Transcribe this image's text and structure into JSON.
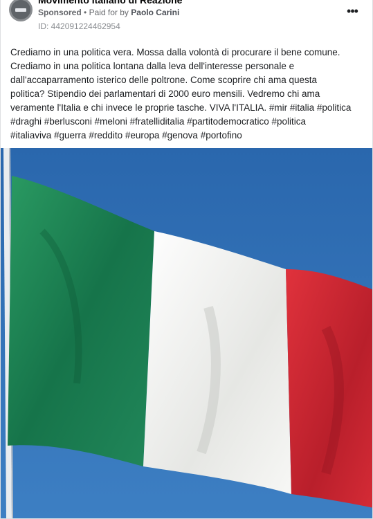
{
  "post": {
    "page_name": "Movimento Italiano di Reazione",
    "sponsored_label": "Sponsored",
    "separator": "•",
    "paid_for_prefix": "Paid for by",
    "payer": "Paolo Carini",
    "ad_id": "ID: 442091224462954",
    "more_icon": "more-horizontal-icon",
    "text": "Crediamo in una politica vera. Mossa dalla volontà di procurare il bene comune.\nCrediamo in una politica lontana dalla leva dell'interesse personale e\ndall'accaparramento isterico delle poltrone. Come scoprire chi ama questa\npolitica? Stipendio dei parlamentari di 2000 euro mensili. Vedremo chi ama\nveramente l'Italia e chi invece le proprie tasche. VIVA l'ITALIA. #mir #italia #politica\n#draghi #berlusconi #meloni #fratelliditalia #partitodemocratico #politica\n#italiaviva #guerra #reddito #europa #genova #portofino"
  },
  "colors": {
    "sky": "#2f6fb4",
    "flag_green": "#1f8a55",
    "flag_white": "#f2f3f1",
    "flag_red": "#d32a35",
    "pole": "#e9ecef"
  }
}
